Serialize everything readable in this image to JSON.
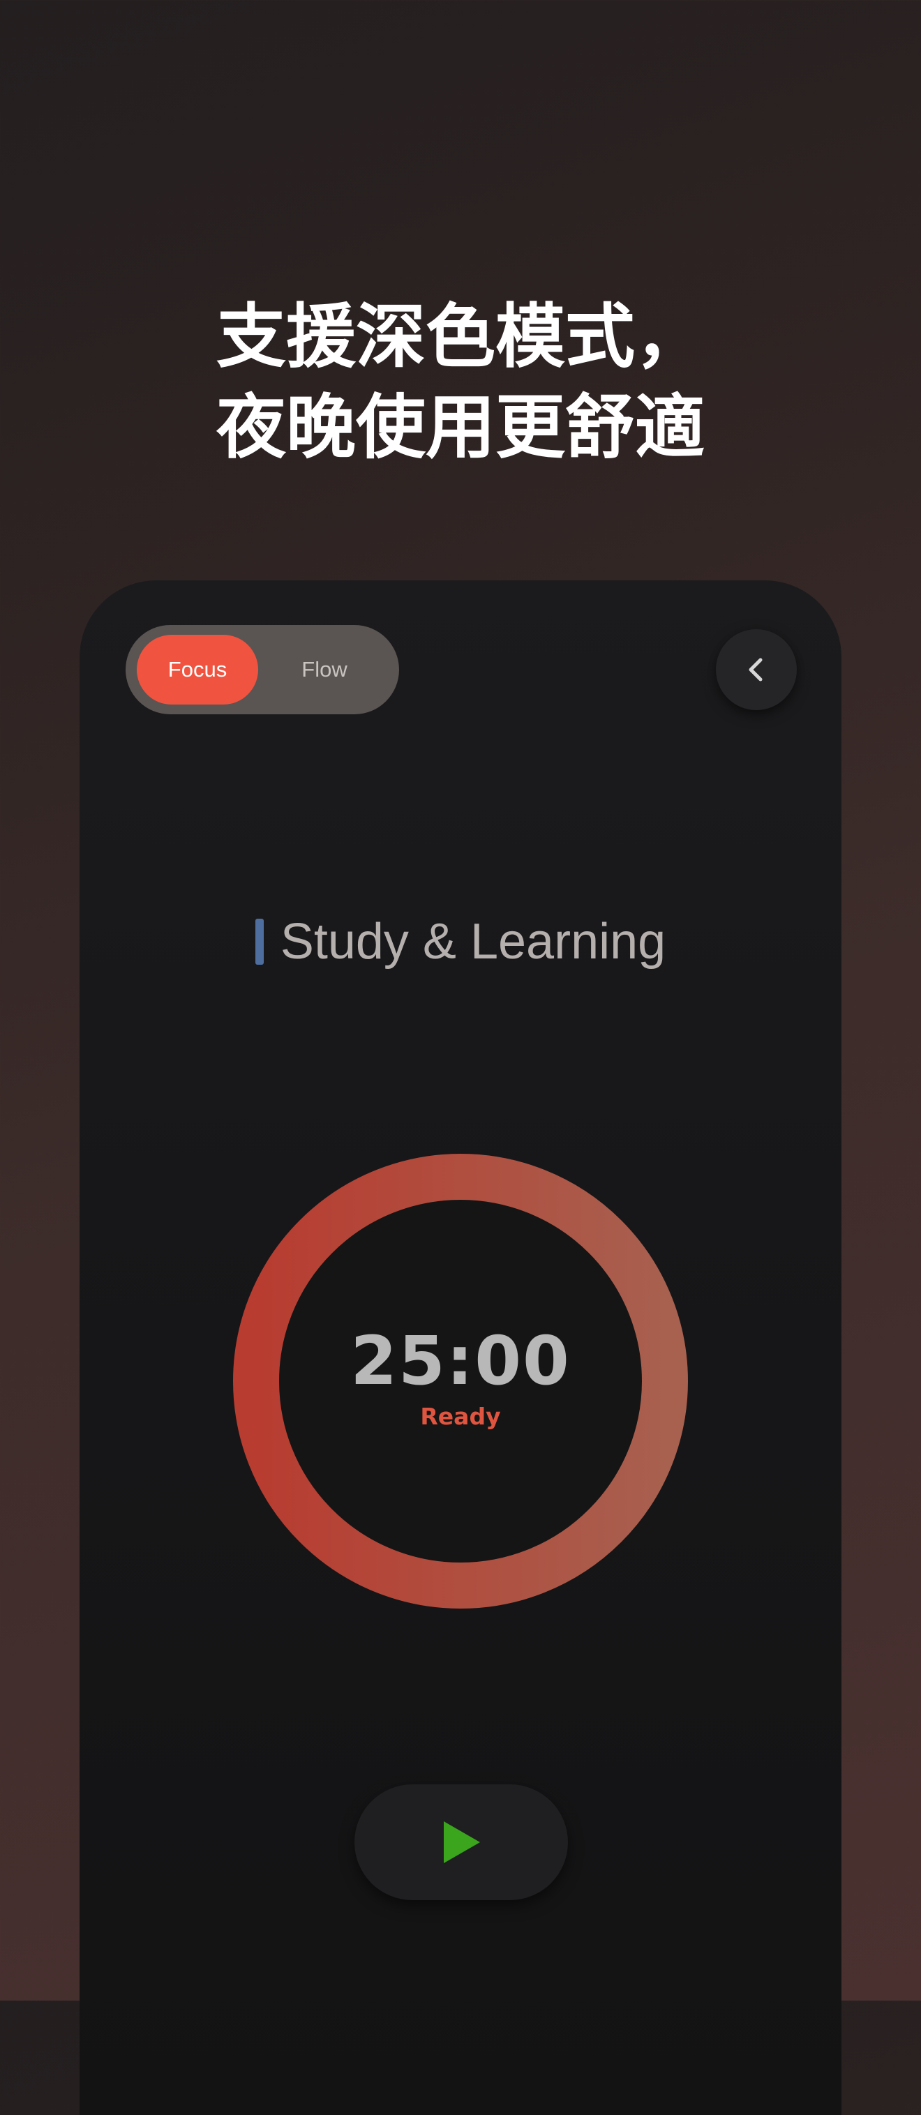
{
  "headline": {
    "line1": "支援深色模式，",
    "line2": "夜晚使用更舒適"
  },
  "mode_toggle": {
    "options": [
      {
        "label": "Focus",
        "selected": true
      },
      {
        "label": "Flow",
        "selected": false
      }
    ]
  },
  "back_button": {
    "icon": "chevron-left-icon"
  },
  "category": {
    "label": "Study & Learning",
    "marker_color": "#4e6ea0"
  },
  "timer": {
    "time": "25:00",
    "status": "Ready",
    "progress": 1.0,
    "ring_color_start": "#b83c30",
    "ring_color_end": "#a8604f"
  },
  "play_button": {
    "icon": "play-icon",
    "color": "#3aa51d"
  },
  "colors": {
    "accent": "#f05440",
    "background": "#2d2322",
    "card": "#171719"
  }
}
